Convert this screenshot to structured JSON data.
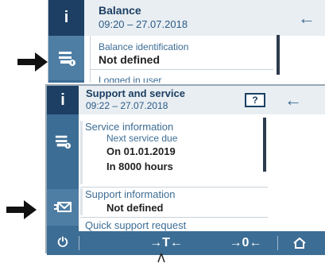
{
  "back_screen": {
    "title": "Balance",
    "subtitle": "09:20 – 27.07.2018",
    "info_tab": "i",
    "rows": [
      {
        "label": "Balance identification",
        "value": "Not defined"
      },
      {
        "label": "Logged in user",
        "value": ""
      }
    ]
  },
  "front_screen": {
    "title": "Support and service",
    "subtitle": "09:22 – 27.07.2018",
    "info_tab": "i",
    "help_label": "?",
    "service": {
      "heading": "Service information",
      "next_label": "Next service due",
      "date_value": "On 01.01.2019",
      "hours_value": "In 8000 hours"
    },
    "support": {
      "heading": "Support information",
      "value": "Not defined"
    },
    "quick_support": "Quick support request",
    "footer": {
      "power": "⏻",
      "tare": "→T←",
      "zero": "→0←",
      "home": "⌂"
    }
  },
  "colors": {
    "accent": "#3c6d95",
    "dark_accent": "#1c3f63",
    "header_bg": "#e9eef2"
  }
}
